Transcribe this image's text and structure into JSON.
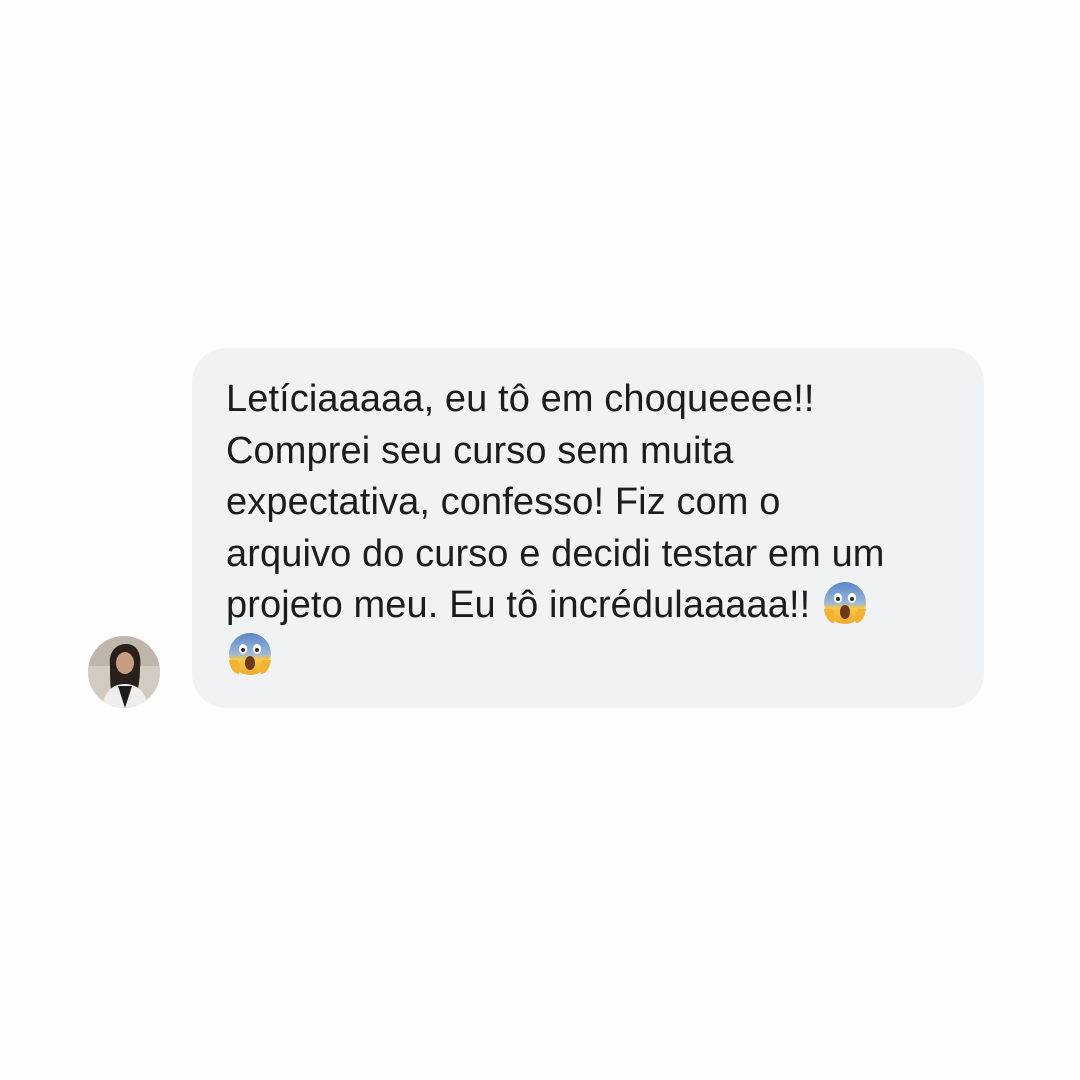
{
  "conversation": {
    "sender": {
      "avatar_icon": "profile-photo"
    },
    "message": {
      "lines": [
        "Letíciaaaaa, eu tô em choqueeee!!",
        "Comprei seu curso sem muita",
        "expectativa, confesso! Fiz com o",
        "arquivo do curso e decidi testar em um",
        "projeto meu. Eu tô incrédulaaaaa!!"
      ],
      "emoji_icon": "face-screaming-in-fear-emoji",
      "emoji_count": 2,
      "bubble_color": "#f1f2f4",
      "text_color": "#1c1c1e"
    }
  }
}
